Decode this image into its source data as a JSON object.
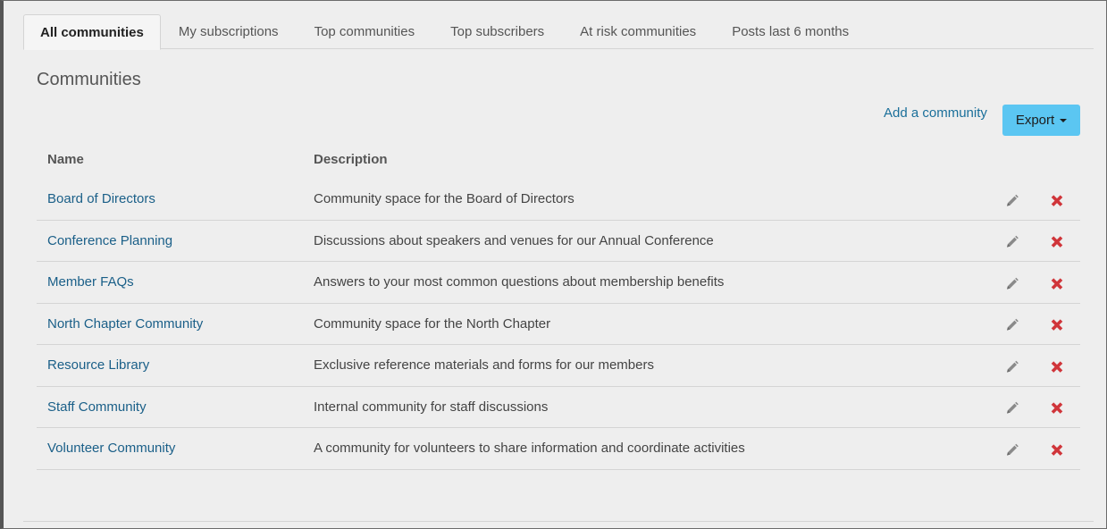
{
  "tabs": [
    {
      "label": "All communities",
      "active": true
    },
    {
      "label": "My subscriptions",
      "active": false
    },
    {
      "label": "Top communities",
      "active": false
    },
    {
      "label": "Top subscribers",
      "active": false
    },
    {
      "label": "At risk communities",
      "active": false
    },
    {
      "label": "Posts last 6 months",
      "active": false
    }
  ],
  "page_title": "Communities",
  "actions": {
    "add_label": "Add a community",
    "export_label": "Export"
  },
  "table": {
    "headers": {
      "name": "Name",
      "description": "Description"
    },
    "rows": [
      {
        "name": "Board of Directors",
        "description": "Community space for the Board of Directors"
      },
      {
        "name": "Conference Planning",
        "description": "Discussions about speakers and venues for our Annual Conference"
      },
      {
        "name": "Member FAQs",
        "description": "Answers to your most common questions about membership benefits"
      },
      {
        "name": "North Chapter Community",
        "description": "Community space for the North Chapter"
      },
      {
        "name": "Resource Library",
        "description": "Exclusive reference materials and forms for our members"
      },
      {
        "name": "Staff Community",
        "description": "Internal community for staff discussions"
      },
      {
        "name": "Volunteer Community",
        "description": "A community for volunteers to share information and coordinate activities"
      }
    ]
  },
  "icons": {
    "edit": "pencil-icon",
    "delete": "close-x-icon"
  },
  "colors": {
    "link": "#1a6f9a",
    "export_button": "#5bc6f2",
    "delete": "#d0353a",
    "edit": "#8a8a8a"
  }
}
